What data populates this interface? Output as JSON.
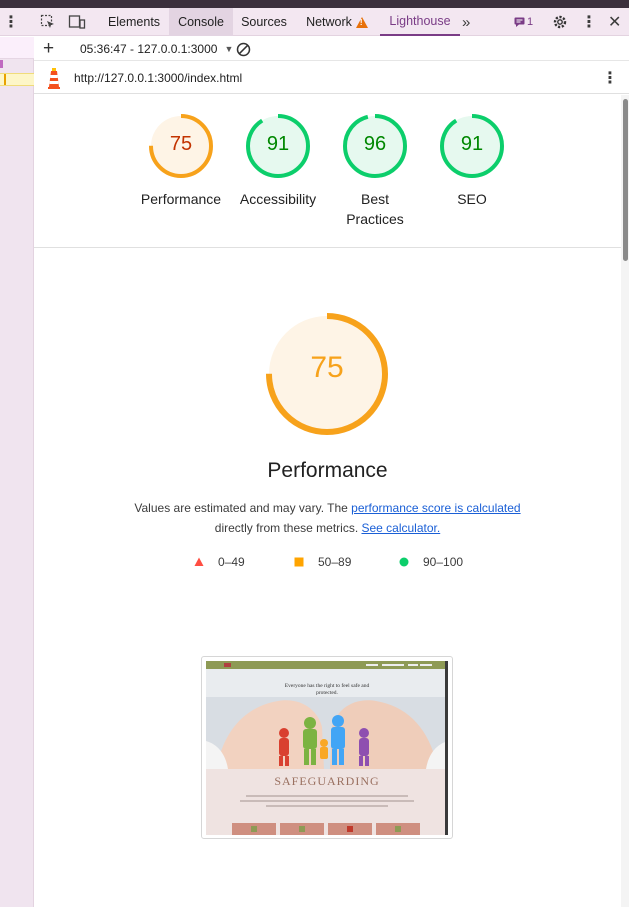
{
  "devtools": {
    "tabs": [
      {
        "label": "Elements"
      },
      {
        "label": "Console"
      },
      {
        "label": "Sources"
      },
      {
        "label": "Network"
      },
      {
        "label": "Lighthouse"
      }
    ],
    "issues_count": "1",
    "active_tab": "Lighthouse"
  },
  "toolbar": {
    "report_selector": "05:36:47 - 127.0.0.1:3000"
  },
  "urlbar": {
    "url": "http://127.0.0.1:3000/index.html"
  },
  "categories": [
    {
      "score": "75",
      "label": "Performance",
      "label2": "",
      "color": "#f7a21b",
      "bg": "#fef4e6",
      "text_color": "#c33300",
      "fraction": 0.75
    },
    {
      "score": "91",
      "label": "Accessibility",
      "label2": "",
      "color": "#0cce6b",
      "bg": "#e6f9ef",
      "text_color": "#008800",
      "fraction": 0.91
    },
    {
      "score": "96",
      "label": "Best",
      "label2": "Practices",
      "color": "#0cce6b",
      "bg": "#e6f9ef",
      "text_color": "#008800",
      "fraction": 0.96
    },
    {
      "score": "91",
      "label": "SEO",
      "label2": "",
      "color": "#0cce6b",
      "bg": "#e6f9ef",
      "text_color": "#008800",
      "fraction": 0.91
    }
  ],
  "main_gauge": {
    "score": "75",
    "title": "Performance",
    "fraction": 0.75,
    "color": "#f7a21b",
    "bg": "#fef4e6"
  },
  "description": {
    "text1": "Values are estimated and may vary. The ",
    "link1": "performance score is calculated",
    "text2": "directly from these metrics. ",
    "link2": "See calculator."
  },
  "legend": [
    {
      "range": "0–49",
      "shape": "triangle",
      "color": "#ff4e42"
    },
    {
      "range": "50–89",
      "shape": "square",
      "color": "#ffa400"
    },
    {
      "range": "90–100",
      "shape": "circle",
      "color": "#0cce6b"
    }
  ],
  "screenshot": {
    "hero_caption": "Everyone has the right to feel safe and protected.",
    "heading": "SAFEGUARDING"
  }
}
